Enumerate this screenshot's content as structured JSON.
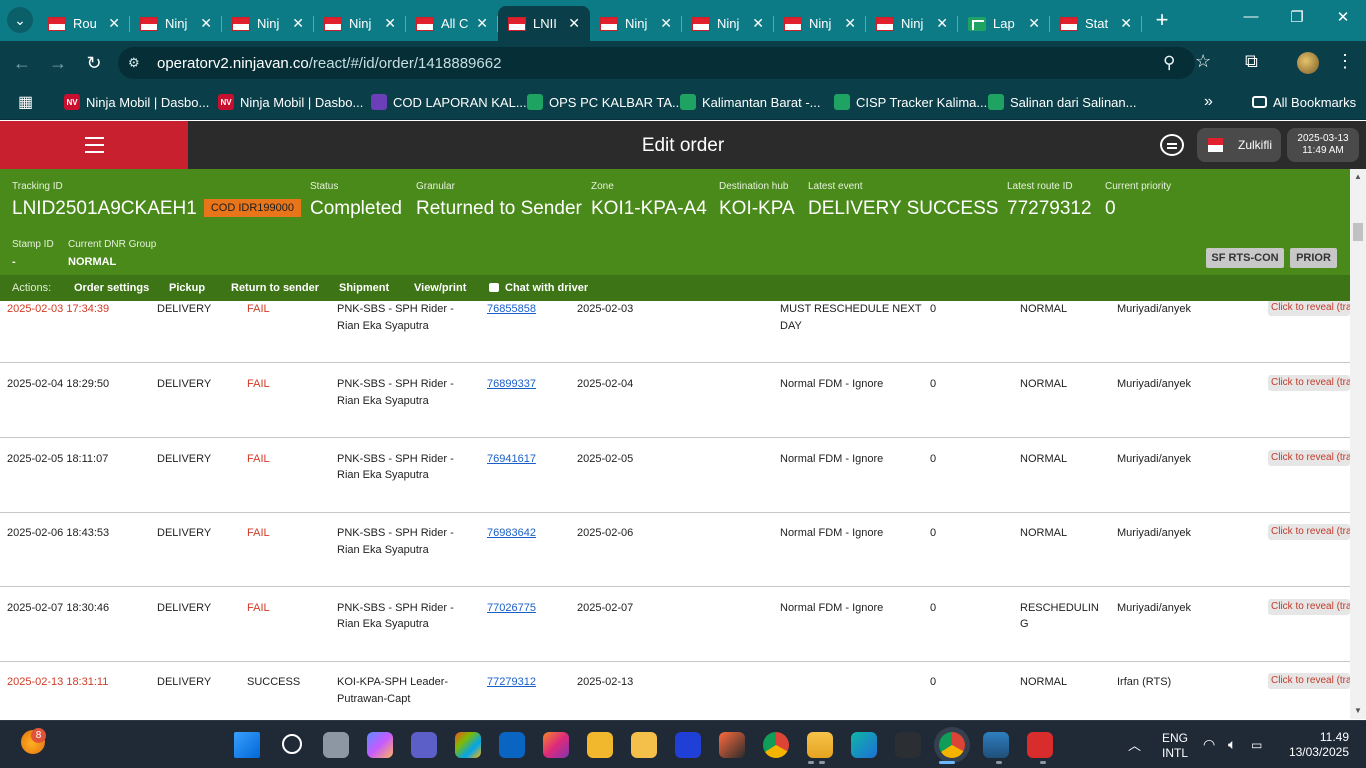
{
  "browser": {
    "tabs": [
      {
        "title": "Rou",
        "favicon": "indonesia-flag-icon",
        "active": false
      },
      {
        "title": "Ninj",
        "favicon": "indonesia-flag-icon",
        "active": false
      },
      {
        "title": "Ninj",
        "favicon": "indonesia-flag-icon",
        "active": false
      },
      {
        "title": "Ninj",
        "favicon": "indonesia-flag-icon",
        "active": false
      },
      {
        "title": "All C",
        "favicon": "indonesia-flag-icon",
        "active": false
      },
      {
        "title": "LNII",
        "favicon": "indonesia-flag-icon",
        "active": true
      },
      {
        "title": "Ninj",
        "favicon": "indonesia-flag-icon",
        "active": false
      },
      {
        "title": "Ninj",
        "favicon": "indonesia-flag-icon",
        "active": false
      },
      {
        "title": "Ninj",
        "favicon": "indonesia-flag-icon",
        "active": false
      },
      {
        "title": "Ninj",
        "favicon": "indonesia-flag-icon",
        "active": false
      },
      {
        "title": "Lap",
        "favicon": "google-sheets-icon",
        "active": false
      },
      {
        "title": "Stat",
        "favicon": "indonesia-flag-icon",
        "active": false
      }
    ],
    "url_host": "operatorv2.ninjavan.co",
    "url_path": "/react/#/id/order/1418889662",
    "bookmarks": [
      {
        "label": "Ninja Mobil | Dasbo...",
        "icon": "nv"
      },
      {
        "label": "Ninja Mobil | Dasbo...",
        "icon": "nv"
      },
      {
        "label": "COD LAPORAN KAL...",
        "icon": "form"
      },
      {
        "label": "OPS PC KALBAR TA...",
        "icon": "sheet"
      },
      {
        "label": "Kalimantan Barat -...",
        "icon": "sheet"
      },
      {
        "label": "CISP Tracker Kalima...",
        "icon": "sheet"
      },
      {
        "label": "Salinan dari Salinan...",
        "icon": "sheet"
      }
    ],
    "all_bookmarks_label": "All Bookmarks"
  },
  "header": {
    "title": "Edit order",
    "user": "Zulkifli",
    "date": "2025-03-13",
    "time": "11:49 AM"
  },
  "summary": {
    "tracking_id_label": "Tracking ID",
    "tracking_id": "LNID2501A9CKAEH1",
    "cod_badge": "COD IDR199000",
    "status_label": "Status",
    "status": "Completed",
    "granular_label": "Granular",
    "granular": "Returned to Sender",
    "zone_label": "Zone",
    "zone": "KOI1-KPA-A4",
    "hub_label": "Destination hub",
    "hub": "KOI-KPA",
    "event_label": "Latest event",
    "event": "DELIVERY SUCCESS",
    "route_label": "Latest route ID",
    "route": "77279312",
    "priority_label": "Current priority",
    "priority": "0",
    "stamp_label": "Stamp ID",
    "stamp": "-",
    "dnr_label": "Current DNR Group",
    "dnr": "NORMAL",
    "sf_button": "SF RTS-CON",
    "prior_button": "PRIOR"
  },
  "actions": {
    "label": "Actions:",
    "items": [
      "Order settings",
      "Pickup",
      "Return to sender",
      "Shipment",
      "View/print",
      "Chat with driver"
    ]
  },
  "history": {
    "partial_row": {
      "date": "2025-02-03 17:34:39",
      "type": "DELIVERY",
      "status": "FAIL",
      "driver": "PNK-SBS - SPH Rider - Rian Eka Syaputra",
      "route": "76855858",
      "route_date": "2025-02-03",
      "reason": "MUST RESCHEDULE NEXT DAY",
      "count": "0",
      "priority": "NORMAL",
      "user": "Muriyadi/anyek",
      "reveal": "Click to reveal (tracking)"
    },
    "rows": [
      {
        "date": "2025-02-04 18:29:50",
        "type": "DELIVERY",
        "status": "FAIL",
        "driver": "PNK-SBS - SPH Rider - Rian Eka Syaputra",
        "route": "76899337",
        "route_date": "2025-02-04",
        "reason": "Normal FDM - Ignore",
        "count": "0",
        "priority": "NORMAL",
        "user": "Muriyadi/anyek",
        "reveal": "Click to reveal (tracking)"
      },
      {
        "date": "2025-02-05 18:11:07",
        "type": "DELIVERY",
        "status": "FAIL",
        "driver": "PNK-SBS - SPH Rider - Rian Eka Syaputra",
        "route": "76941617",
        "route_date": "2025-02-05",
        "reason": "Normal FDM - Ignore",
        "count": "0",
        "priority": "NORMAL",
        "user": "Muriyadi/anyek",
        "reveal": "Click to reveal (tracking)"
      },
      {
        "date": "2025-02-06 18:43:53",
        "type": "DELIVERY",
        "status": "FAIL",
        "driver": "PNK-SBS - SPH Rider - Rian Eka Syaputra",
        "route": "76983642",
        "route_date": "2025-02-06",
        "reason": "Normal FDM - Ignore",
        "count": "0",
        "priority": "NORMAL",
        "user": "Muriyadi/anyek",
        "reveal": "Click to reveal (tracking)"
      },
      {
        "date": "2025-02-07 18:30:46",
        "type": "DELIVERY",
        "status": "FAIL",
        "driver": "PNK-SBS - SPH Rider - Rian Eka Syaputra",
        "route": "77026775",
        "route_date": "2025-02-07",
        "reason": "Normal FDM - Ignore",
        "count": "0",
        "priority": "RESCHEDULING",
        "user": "Muriyadi/anyek",
        "reveal": "Click to reveal (tracking)"
      },
      {
        "date": "2025-02-13 18:31:11",
        "type": "DELIVERY",
        "status": "SUCCESS",
        "driver": "KOI-KPA-SPH Leader- Putrawan-Capt",
        "route": "77279312",
        "route_date": "2025-02-13",
        "reason": "",
        "count": "0",
        "priority": "NORMAL",
        "user": "Irfan (RTS)",
        "reveal": "Click to reveal (tracking)"
      }
    ]
  },
  "taskbar": {
    "notification_count": "8",
    "apps": [
      "windows-start-icon",
      "search-icon",
      "task-view-icon",
      "copilot-icon",
      "teams-icon",
      "store-icon",
      "outlook-icon",
      "instagram-icon",
      "pen-app-icon",
      "files-app-icon",
      "malwarebytes-icon",
      "screen-tool-icon",
      "chrome-icon",
      "file-explorer-icon",
      "edge-icon",
      "whatsapp-icon",
      "chrome-profile-icon",
      "remote-desktop-icon",
      "wps-office-icon"
    ],
    "lang_top": "ENG",
    "lang_bottom": "INTL",
    "time": "11.49",
    "date": "13/03/2025"
  },
  "colors": {
    "tab_bar": "#0d7b86",
    "toolbar": "#0a3f4a",
    "menu_red": "#c8202f",
    "summary_green": "#4a8a1a",
    "actions_green": "#3d7416",
    "cod_orange": "#e8751a",
    "fail_red": "#d03b26",
    "link_blue": "#1a5fc9"
  }
}
